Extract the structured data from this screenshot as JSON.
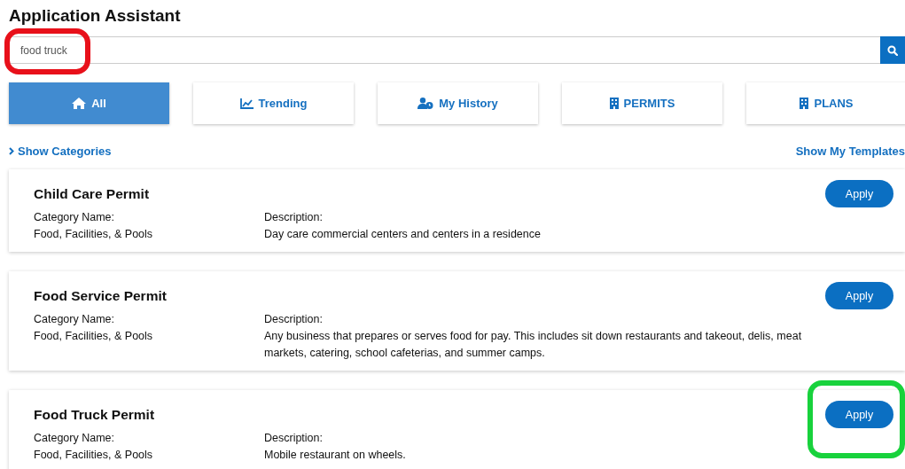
{
  "title": "Application Assistant",
  "search": {
    "value": "food truck",
    "highlighted": true
  },
  "tabs": [
    {
      "label": "All",
      "selected": true
    },
    {
      "label": "Trending",
      "selected": false
    },
    {
      "label": "My History",
      "selected": false
    },
    {
      "label": "PERMITS",
      "selected": false
    },
    {
      "label": "PLANS",
      "selected": false
    }
  ],
  "show_categories": "Show Categories",
  "show_templates": "Show My Templates",
  "results": [
    {
      "name": "Child Care Permit",
      "category_label": "Category Name:",
      "category": "Food, Facilities, & Pools",
      "description_label": "Description:",
      "description": "Day care commercial centers and centers in a residence",
      "button": "Apply"
    },
    {
      "name": "Food Service Permit",
      "category_label": "Category Name:",
      "category": "Food, Facilities, & Pools",
      "description_label": "Description:",
      "description": "Any business that prepares or serves food for pay. This includes sit down restaurants and takeout, delis, meat markets, catering, school cafeterias, and summer camps.",
      "button": "Apply"
    },
    {
      "name": "Food Truck Permit",
      "category_label": "Category Name:",
      "category": "Food, Facilities, & Pools",
      "description_label": "Description:",
      "description": "Mobile restaurant on wheels.",
      "button": "Apply",
      "highlighted": true
    }
  ]
}
